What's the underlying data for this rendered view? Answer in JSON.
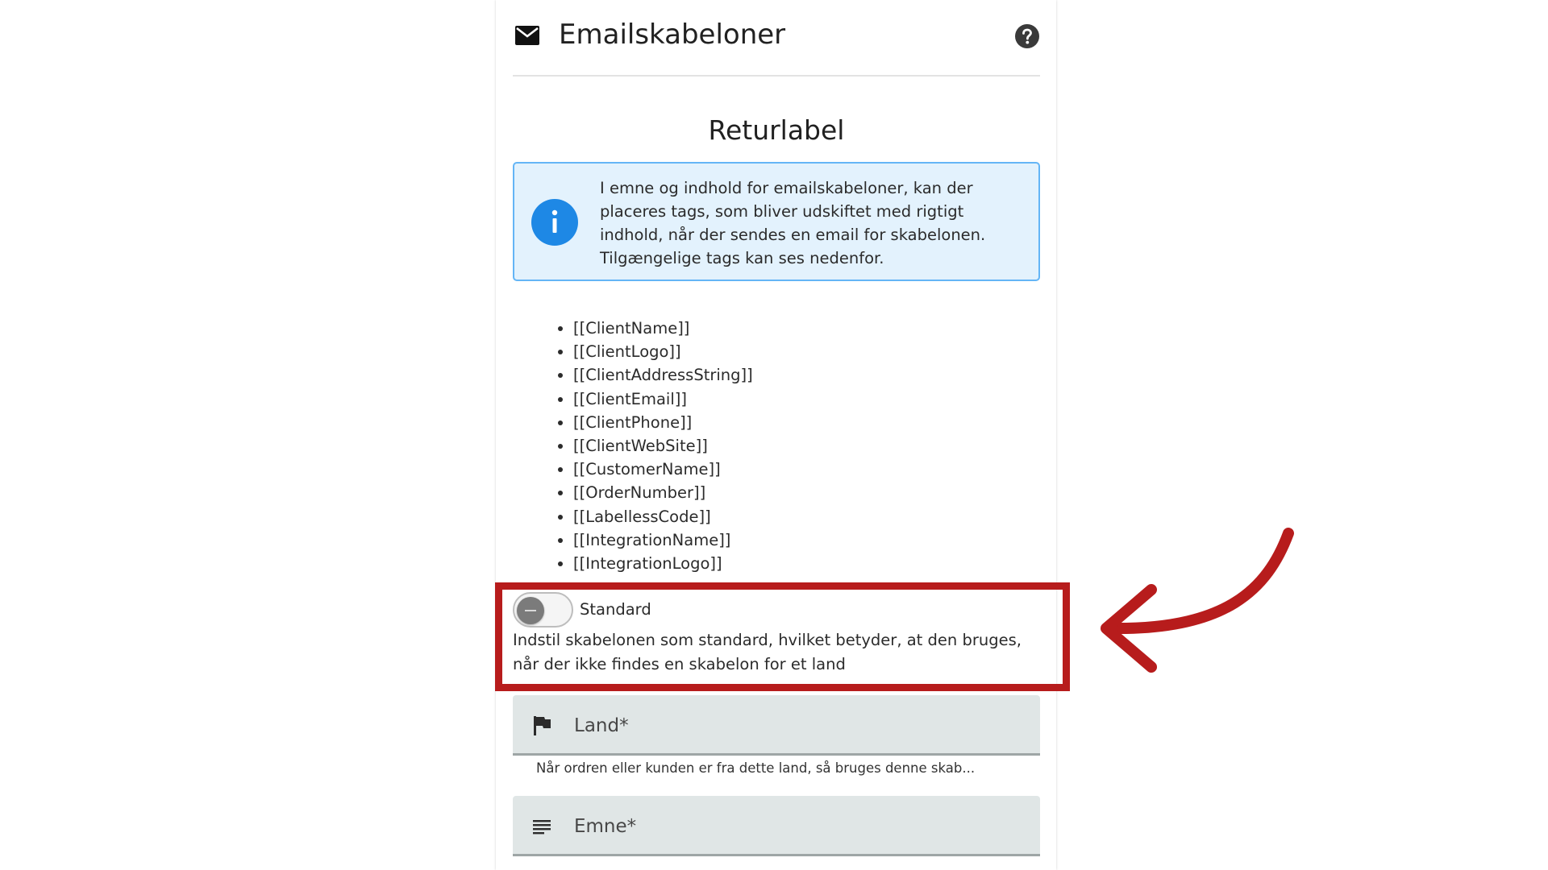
{
  "header": {
    "title": "Emailskabeloner",
    "mail_icon": "mail-icon",
    "help_icon": "help-icon"
  },
  "section": {
    "title": "Returlabel"
  },
  "info_box": {
    "icon": "info-icon",
    "text": "I emne og indhold for emailskabeloner, kan der placeres tags, som bliver udskiftet med rigtigt indhold, når der sendes en email for skabelonen. Tilgængelige tags kan ses nedenfor."
  },
  "tags": [
    "[[ClientName]]",
    "[[ClientLogo]]",
    "[[ClientAddressString]]",
    "[[ClientEmail]]",
    "[[ClientPhone]]",
    "[[ClientWebSite]]",
    "[[CustomerName]]",
    "[[OrderNumber]]",
    "[[LabellessCode]]",
    "[[IntegrationName]]",
    "[[IntegrationLogo]]"
  ],
  "standard_toggle": {
    "label": "Standard",
    "state": "off",
    "description": "Indstil skabelonen som standard, hvilket betyder, at den bruges, når der ikke findes en skabelon for et land"
  },
  "fields": {
    "land": {
      "label": "Land*",
      "icon": "flag-icon",
      "hint": "Når ordren eller kunden er fra dette land, så bruges denne skab..."
    },
    "emne": {
      "label": "Emne*",
      "icon": "subject-lines-icon"
    }
  },
  "colors": {
    "accent_blue": "#1e88e5",
    "info_bg": "#e3f2fd",
    "info_border": "#64b5f6",
    "highlight_red": "#b71c1c",
    "field_bg": "#e0e6e6"
  }
}
